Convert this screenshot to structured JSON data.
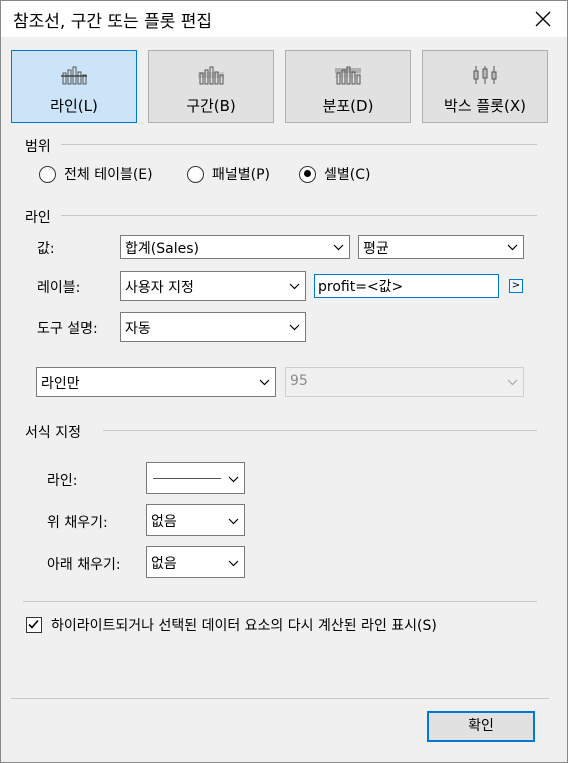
{
  "window": {
    "title": "참조선, 구간 또는 플롯 편집"
  },
  "tabs": [
    {
      "label": "라인(L)",
      "icon": "line-bars-icon",
      "active": true
    },
    {
      "label": "구간(B)",
      "icon": "band-bars-icon",
      "active": false
    },
    {
      "label": "분포(D)",
      "icon": "distribution-bars-icon",
      "active": false
    },
    {
      "label": "박스 플롯(X)",
      "icon": "box-plot-icon",
      "active": false
    }
  ],
  "scope": {
    "title": "범위",
    "options": [
      {
        "label": "전체 테이블(E)",
        "selected": false
      },
      {
        "label": "패널별(P)",
        "selected": false
      },
      {
        "label": "셀별(C)",
        "selected": true
      }
    ]
  },
  "line": {
    "title": "라인",
    "value_label": "값:",
    "value_field": "합계(Sales)",
    "value_agg": "평균",
    "label_label": "레이블:",
    "label_mode": "사용자 지정",
    "label_text": "profit=<값>",
    "label_insert_button": ">",
    "tooltip_label": "도구 설명:",
    "tooltip_mode": "자동",
    "display_mode": "라인만",
    "confidence": "95"
  },
  "format": {
    "title": "서식 지정",
    "line_label": "라인:",
    "fill_above_label": "위 채우기:",
    "fill_above_value": "없음",
    "fill_below_label": "아래 채우기:",
    "fill_below_value": "없음"
  },
  "recalc": {
    "label": "하이라이트되거나 선택된 데이터 요소의 다시 계산된 라인 표시(S)",
    "checked": true
  },
  "footer": {
    "ok_label": "확인"
  },
  "colors": {
    "accent": "#0078d7",
    "active_tab_bg": "#cce4f7"
  }
}
